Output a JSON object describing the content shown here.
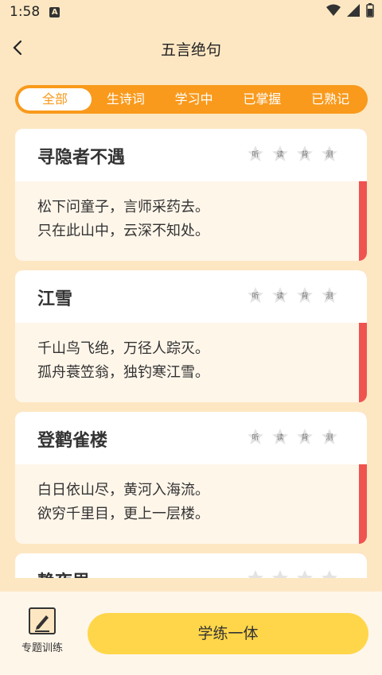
{
  "status": {
    "time": "1:58",
    "badge": "A"
  },
  "header": {
    "title": "五言绝句"
  },
  "tabs": [
    {
      "label": "全部",
      "active": true
    },
    {
      "label": "生诗词",
      "active": false
    },
    {
      "label": "学习中",
      "active": false
    },
    {
      "label": "已掌握",
      "active": false
    },
    {
      "label": "已熟记",
      "active": false
    }
  ],
  "poems": [
    {
      "title": "寻隐者不遇",
      "lines": [
        "松下问童子，言师采药去。",
        "只在此山中，云深不知处。"
      ]
    },
    {
      "title": "江雪",
      "lines": [
        "千山鸟飞绝，万径人踪灭。",
        "孤舟蓑笠翁，独钓寒江雪。"
      ]
    },
    {
      "title": "登鹳雀楼",
      "lines": [
        "白日依山尽，黄河入海流。",
        "欲穷千里目，更上一层楼。"
      ]
    },
    {
      "title": "静夜思",
      "lines": [
        "",
        ""
      ]
    }
  ],
  "stars": [
    "听",
    "读",
    "背",
    "测"
  ],
  "bottom": {
    "topic_label": "专题训练",
    "practice_label": "学练一体"
  },
  "colors": {
    "accent": "#f99a1c",
    "stripe": "#ef5350",
    "button": "#ffd64a",
    "background": "#fde7c2"
  }
}
